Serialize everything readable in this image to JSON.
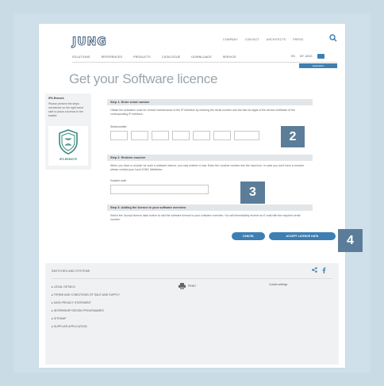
{
  "brand": {
    "logo": "JUNG"
  },
  "topnav": [
    "COMPANY",
    "CONTACT",
    "ARCHITECTS",
    "PRESS"
  ],
  "mainnav": [
    "SOLUTIONS",
    "REFERENCES",
    "PRODUCTS",
    "CATALOGUE",
    "DOWNLOADS",
    "SERVICE"
  ],
  "lang": {
    "label": "EN",
    "account": "MY JUNG"
  },
  "active_tab": "Application",
  "page": {
    "title": "Get your Software licence"
  },
  "card": {
    "title": "IPS-Remote",
    "text": "Please perform the steps mentioned on the right-hand side to place a licence in the basket.",
    "badge_label": "IPS-REMOTE"
  },
  "step1": {
    "title": "Step 1: Enter serial number",
    "text": "Obtain the activation code for remote maintenance of the IP interface by entering the serial number and the last six digits of the device certificate of the corresponding IP interface.",
    "field_label": "Serial number"
  },
  "step2": {
    "title": "Step 2: Redeem voucher",
    "text": "When you have a voucher for such a software licence, you may redeem it now. Enter the voucher number into the input box. In case you don't have a voucher please contact your local JUNG distributor.",
    "field_label": "Voucher code"
  },
  "step3": {
    "title": "Step 3: Adding the licence to your software overview",
    "text": "Select the 'Accept licence data' button to add the software licence to your software overview. You will immediately receive an E-mail with the required serial number."
  },
  "buttons": {
    "cancel": "CANCEL",
    "accept": "ACCEPT LICENCE DATA"
  },
  "callouts": [
    "2",
    "3",
    "4"
  ],
  "footer": {
    "heading": "SWITCHES AND SYSTEMS",
    "links": [
      "LEGAL DETAILS",
      "TERMS AND CONDITIONS OF SALE AND SUPPLY",
      "DATA PRIVACY STATEMENT",
      "INTERNSHIP DESIGN PROGRAMMES",
      "SITEMAP",
      "SUPPLIER APPLICATION"
    ],
    "print": "PRINT",
    "cookie": "Cookie settings"
  },
  "colors": {
    "accent": "#3d7fb3",
    "callout": "#5b7d99",
    "frame": "#c9dce6"
  }
}
